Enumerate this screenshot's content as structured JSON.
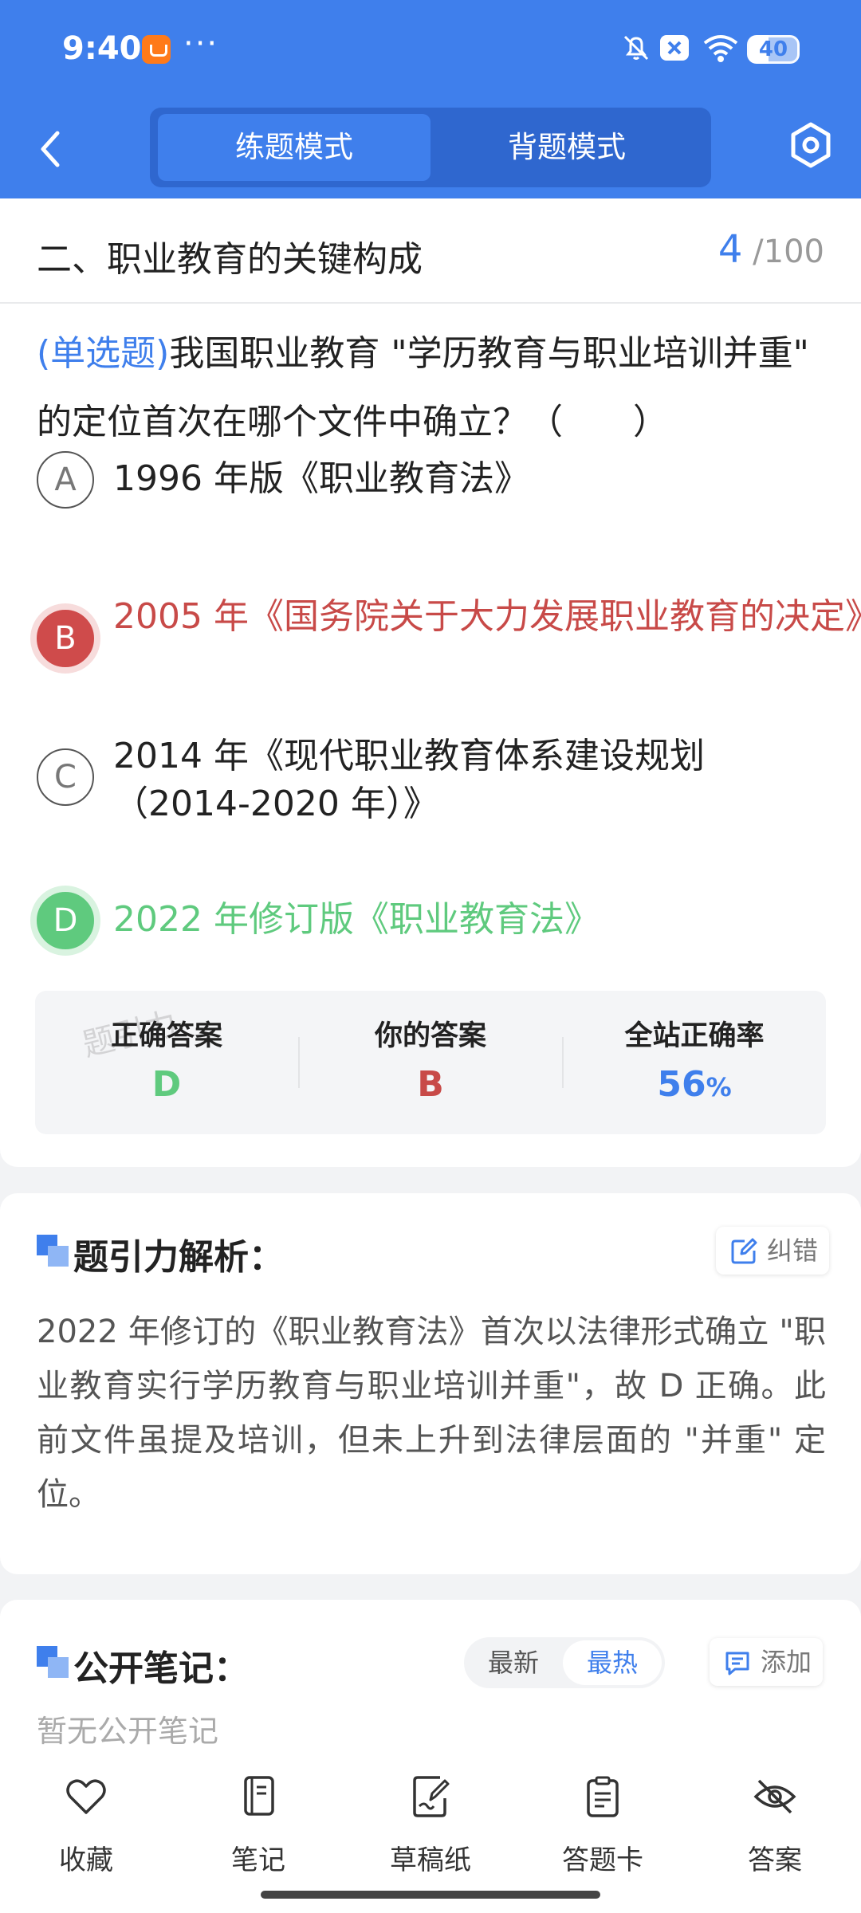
{
  "status_bar": {
    "time": "9:40",
    "more": "···",
    "battery": "40"
  },
  "nav": {
    "tab_practice": "练题模式",
    "tab_memorize": "背题模式"
  },
  "section": {
    "title": "二、职业教育的关键构成",
    "current": "4",
    "total": "/100"
  },
  "question": {
    "type": "(单选题)",
    "text": "我国职业教育 \"学历教育与职业培训并重\" 的定位首次在哪个文件中确立？（　　）"
  },
  "options": [
    {
      "letter": "A",
      "text": "1996 年版《职业教育法》",
      "state": "normal"
    },
    {
      "letter": "B",
      "text": "2005 年《国务院关于大力发展职业教育的决定》",
      "state": "wrong"
    },
    {
      "letter": "C",
      "text": "2014 年《现代职业教育体系建设规划（2014-2020 年）》",
      "state": "normal"
    },
    {
      "letter": "D",
      "text": "2022 年修订版《职业教育法》",
      "state": "correct"
    }
  ],
  "answer_summary": {
    "watermark": "题引力",
    "correct_label": "正确答案",
    "correct_value": "D",
    "yours_label": "你的答案",
    "yours_value": "B",
    "rate_label": "全站正确率",
    "rate_value": "56",
    "rate_unit": "%",
    "colors": {
      "correct": "#5fca7e",
      "wrong": "#c84a48",
      "accent": "#3f7fec"
    }
  },
  "analysis": {
    "title": "题引力解析：",
    "report_label": "纠错",
    "body": "2022 年修订的《职业教育法》首次以法律形式确立 \"职业教育实行学历教育与职业培训并重\"，故 D 正确。此前文件虽提及培训，但未上升到法律层面的 \"并重\" 定位。"
  },
  "notes": {
    "title": "公开笔记：",
    "sort_latest": "最新",
    "sort_hot": "最热",
    "add_label": "添加",
    "empty_text": "暂无公开笔记"
  },
  "toolbar": [
    {
      "label": "收藏",
      "icon": "heart-icon"
    },
    {
      "label": "笔记",
      "icon": "notebook-icon"
    },
    {
      "label": "草稿纸",
      "icon": "draft-paper-icon"
    },
    {
      "label": "答题卡",
      "icon": "answer-card-icon"
    },
    {
      "label": "答案",
      "icon": "eye-off-icon"
    }
  ]
}
